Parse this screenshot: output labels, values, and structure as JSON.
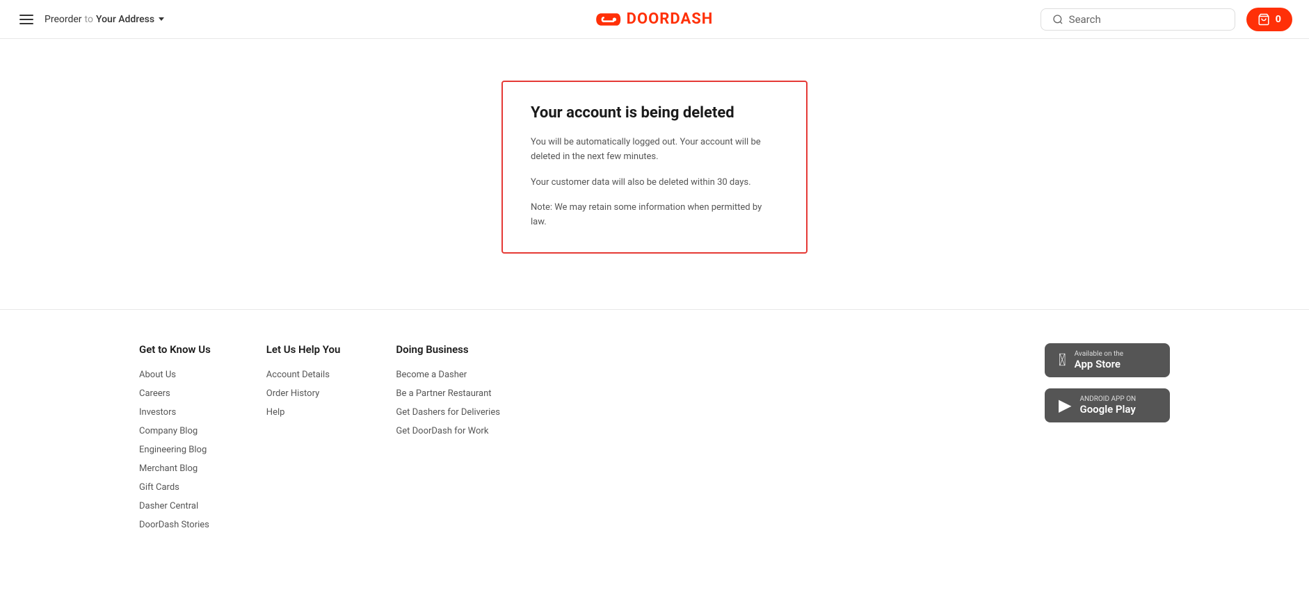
{
  "header": {
    "preorder_label": "Preorder",
    "to_word": "to",
    "address_label": "Your Address",
    "logo_text": "DOORDASH",
    "search_placeholder": "Search",
    "cart_count": "0"
  },
  "main": {
    "card": {
      "title": "Your account is being deleted",
      "paragraph1": "You will be automatically logged out. Your account will be deleted in the next few minutes.",
      "paragraph2": "Your customer data will also be deleted within 30 days.",
      "note": "Note: We may retain some information when permitted by law."
    }
  },
  "footer": {
    "columns": [
      {
        "title": "Get to Know Us",
        "links": [
          "About Us",
          "Careers",
          "Investors",
          "Company Blog",
          "Engineering Blog",
          "Merchant Blog",
          "Gift Cards",
          "Dasher Central",
          "DoorDash Stories"
        ]
      },
      {
        "title": "Let Us Help You",
        "links": [
          "Account Details",
          "Order History",
          "Help"
        ]
      },
      {
        "title": "Doing Business",
        "links": [
          "Become a Dasher",
          "Be a Partner Restaurant",
          "Get Dashers for Deliveries",
          "Get DoorDash for Work"
        ]
      }
    ],
    "app_store": {
      "sub": "Available on the",
      "main": "App Store"
    },
    "google_play": {
      "sub": "ANDROID APP ON",
      "main": "Google Play"
    }
  }
}
